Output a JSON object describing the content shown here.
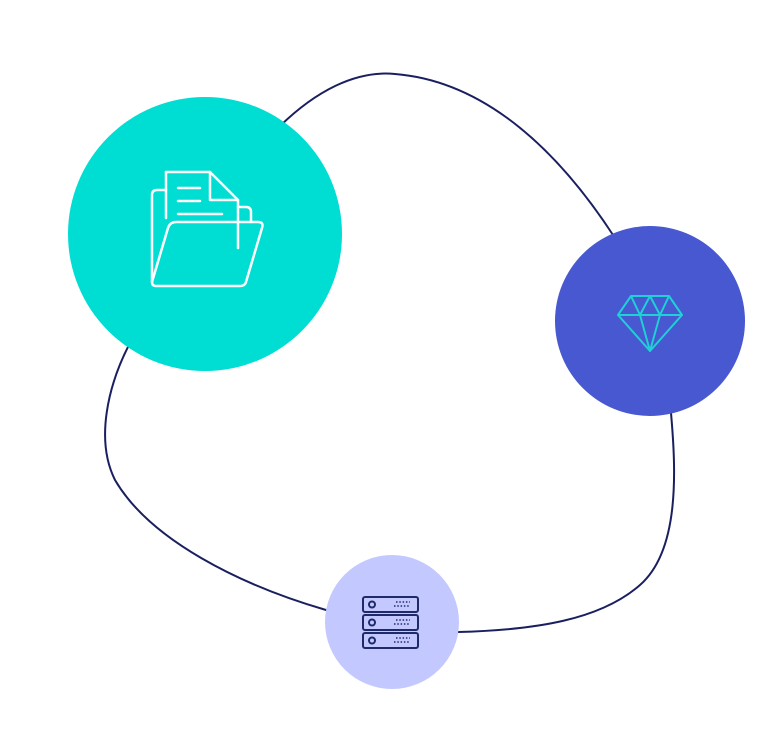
{
  "diagram": {
    "nodes": [
      {
        "id": "documents",
        "icon": "folder-documents-icon",
        "fill": "#00DDD3",
        "icon_color": "#FFFFFF"
      },
      {
        "id": "premium",
        "icon": "diamond-icon",
        "fill": "#4758D0",
        "icon_color": "#1FD0D6"
      },
      {
        "id": "servers",
        "icon": "server-rack-icon",
        "fill": "#C3C9FF",
        "icon_color": "#1F2A6B"
      }
    ],
    "connector": {
      "shape": "closed-loop",
      "stroke": "#1A1F60"
    }
  }
}
